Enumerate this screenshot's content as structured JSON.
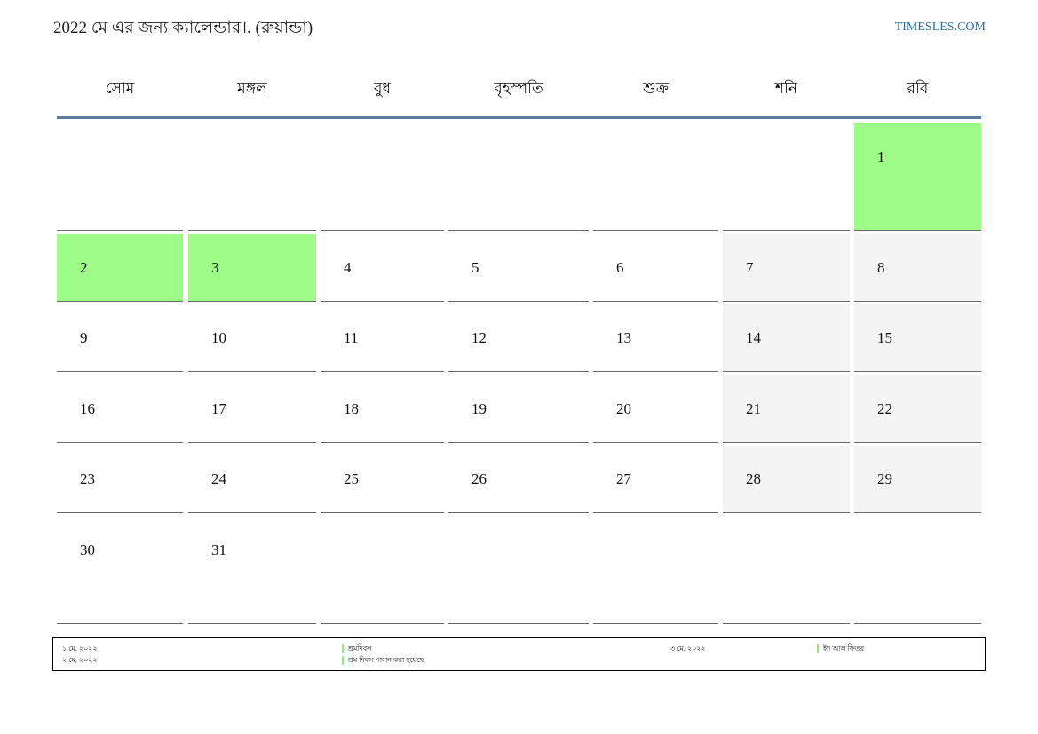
{
  "header": {
    "title": "2022 মে এর জন্য ক্যালেন্ডার।. (রুয়ান্ডা)",
    "site": "TIMESLES.COM"
  },
  "weekdays": [
    "সোম",
    "মঙ্গল",
    "বুধ",
    "বৃহস্পতি",
    "শুক্র",
    "শনি",
    "রবি"
  ],
  "days": [
    "1",
    "2",
    "3",
    "4",
    "5",
    "6",
    "7",
    "8",
    "9",
    "10",
    "11",
    "12",
    "13",
    "14",
    "15",
    "16",
    "17",
    "18",
    "19",
    "20",
    "21",
    "22",
    "23",
    "24",
    "25",
    "26",
    "27",
    "28",
    "29",
    "30",
    "31"
  ],
  "holiday_days": [
    "1",
    "2",
    "3"
  ],
  "legend": [
    {
      "date": "১ মে, ২০২২",
      "name": "শ্রমদিবস"
    },
    {
      "date": "২ মে, ২০২২",
      "name": "শ্রম দিবস পালন করা হয়েছে"
    },
    {
      "date": "৩ মে, ২০২২",
      "name": "ইদ আল ফিতর"
    }
  ],
  "colors": {
    "holiday": "#9efc88",
    "weekend": "#f4f4f4",
    "header_rule": "#5f7aa0",
    "link": "#2a6fa8"
  }
}
